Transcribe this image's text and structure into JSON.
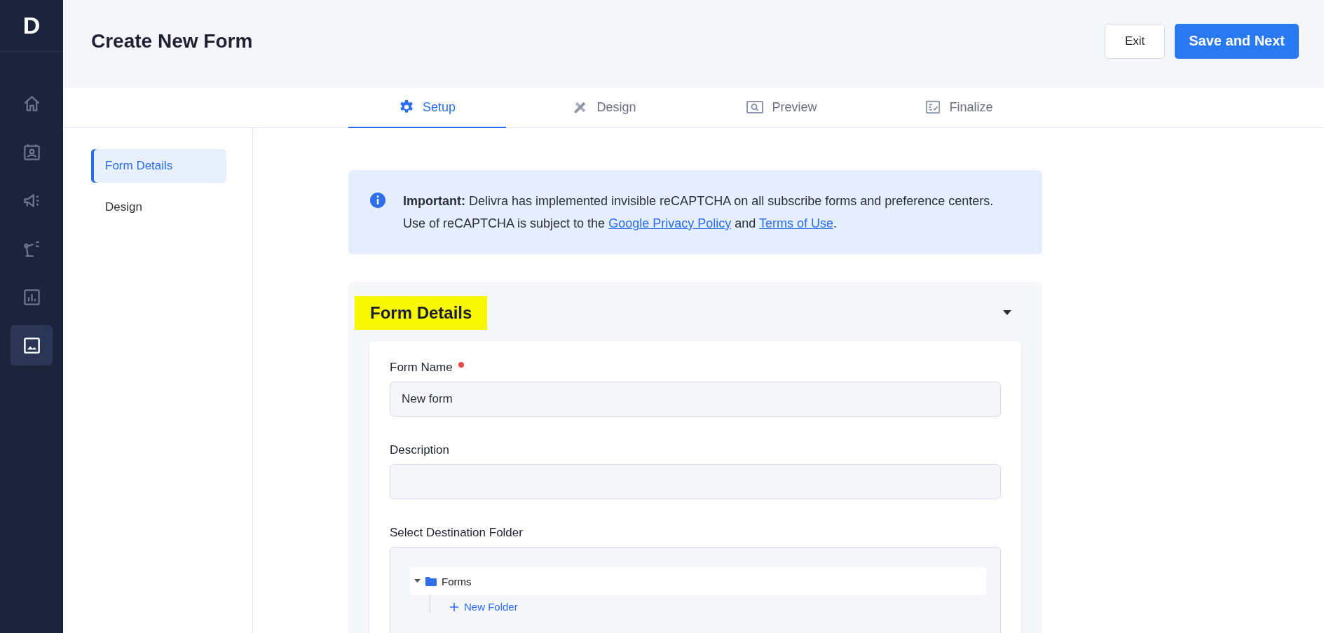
{
  "logo": {
    "letter": "D"
  },
  "sidebar": {
    "items": [
      {
        "kind": "home",
        "selected": false
      },
      {
        "kind": "contacts",
        "selected": false
      },
      {
        "kind": "campaigns",
        "selected": false
      },
      {
        "kind": "automation",
        "selected": false
      },
      {
        "kind": "reports",
        "selected": false
      },
      {
        "kind": "content",
        "selected": true
      }
    ]
  },
  "header": {
    "title": "Create New Form",
    "buttons": [
      {
        "label": "Exit",
        "kind": "secondary"
      },
      {
        "label": "Save and Next",
        "kind": "primary"
      }
    ]
  },
  "tabs": [
    {
      "label": "Setup",
      "kind": "setup",
      "selected": true
    },
    {
      "label": "Design",
      "kind": "design",
      "selected": false
    },
    {
      "label": "Preview",
      "kind": "preview",
      "selected": false
    },
    {
      "label": "Finalize",
      "kind": "finalize",
      "selected": false
    }
  ],
  "subnav": [
    {
      "label": "Form Details",
      "selected": true
    },
    {
      "label": "Design",
      "selected": false
    }
  ],
  "notice": {
    "text": "**Important:** Delivra has implemented invisible reCAPTCHA on all subscribe forms and preference centers. Use of reCAPTCHA is subject to the ",
    "links": [
      "Google Privacy Policy",
      "Terms of Use"
    ],
    "joiner": " and ",
    "end": "."
  },
  "section": {
    "title": "Form Details",
    "highlighted": true,
    "expanded": true,
    "fields": [
      {
        "label": "Form Name",
        "required": true,
        "value": "New form"
      },
      {
        "label": "Description",
        "required": false
      }
    ],
    "folder": {
      "label": "Select Destination Folder",
      "tree": [
        {
          "label": "Forms",
          "expanded": true,
          "children": [
            {
              "label": "New Folder",
              "kind": "action"
            }
          ]
        }
      ]
    }
  }
}
